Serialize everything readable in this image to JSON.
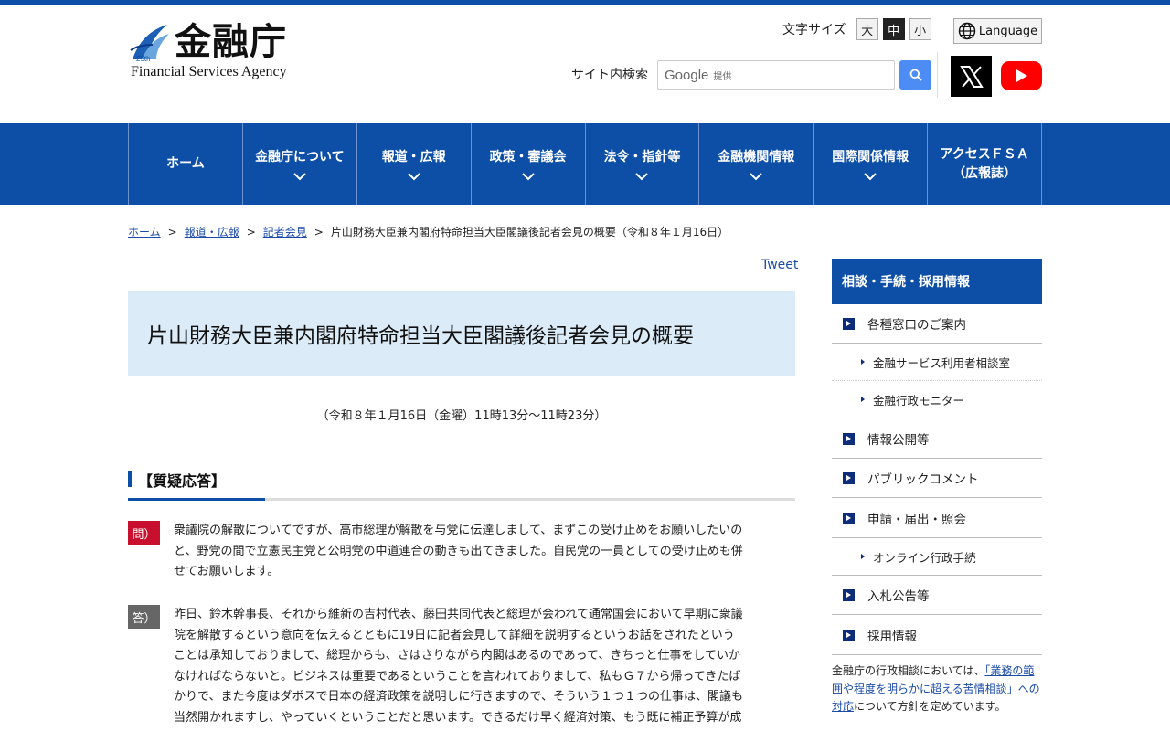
{
  "header": {
    "logo_jp": "金融庁",
    "logo_en": "Financial Services Agency",
    "logo_badge": "25th",
    "font_size_label": "文字サイズ",
    "font_sizes": [
      "大",
      "中",
      "小"
    ],
    "font_size_active": "中",
    "language_label": "Language",
    "search_label": "サイト内検索",
    "search_brand": "Google",
    "search_provided": "提供",
    "accent_color": "#0d4ea6"
  },
  "nav": {
    "items": [
      {
        "label": "ホーム",
        "sub": ""
      },
      {
        "label": "金融庁について",
        "sub": ""
      },
      {
        "label": "報道・広報",
        "sub": ""
      },
      {
        "label": "政策・審議会",
        "sub": ""
      },
      {
        "label": "法令・指針等",
        "sub": ""
      },
      {
        "label": "金融機関情報",
        "sub": ""
      },
      {
        "label": "国際関係情報",
        "sub": ""
      },
      {
        "label": "アクセスＦＳＡ",
        "sub": "（広報誌）"
      }
    ]
  },
  "breadcrumb": {
    "home": "ホーム",
    "press": "報道・広報",
    "conference": "記者会見",
    "current": "片山財務大臣兼内閣府特命担当大臣閣議後記者会見の概要（令和８年１月16日）"
  },
  "article": {
    "tweet": "Tweet",
    "title": "片山財務大臣兼内閣府特命担当大臣閣議後記者会見の概要",
    "date": "（令和８年１月16日（金曜）11時13分～11時23分）",
    "section_title": "【質疑応答】",
    "q_badge": "問）",
    "a_badge": "答）",
    "q1_lines": [
      "衆議院の解散についてですが、高市総理が解散を与党に伝達しまして、まずこの受け止めをお願いしたいの",
      "と、野党の間で立憲民主党と公明党の中道連合の動きも出てきました。自民党の一員としての受け止めも併",
      "せてお願いします。"
    ],
    "a1_lines": [
      "昨日、鈴木幹事長、それから維新の吉村代表、藤田共同代表と総理が会われて通常国会において早期に衆議",
      "院を解散するという意向を伝えるとともに19日に記者会見して詳細を説明するというお話をされたという",
      "ことは承知しておりまして、総理からも、さはさりながら内閣はあるのであって、きちっと仕事をしていか",
      "なければならないと。ビジネスは重要であるということを言われておりまして、私もＧ７から帰ってきたば",
      "かりで、また今度はダボスで日本の経済政策を説明しに行きますので、そういう１つ１つの仕事は、閣議も",
      "当然開かれますし、やっていくということだと思います。できるだけ早く経済対策、もう既に補正予算が成"
    ]
  },
  "sidebar": {
    "heading": "相談・手続・採用情報",
    "items": {
      "madoguchi": "各種窓口のご案内",
      "sodanshitsu": "金融サービス利用者相談室",
      "monitor": "金融行政モニター",
      "johokokai": "情報公開等",
      "public_comment": "パブリックコメント",
      "shinsei": "申請・届出・照会",
      "online": "オンライン行政手続",
      "nyusatsu": "入札公告等",
      "saiyo": "採用情報"
    },
    "note_prefix": "金融庁の行政相談においては、",
    "note_link": "「業務の範囲や程度を明らかに超える苦情相談」への対応",
    "note_suffix": "について方針を定めています。"
  }
}
